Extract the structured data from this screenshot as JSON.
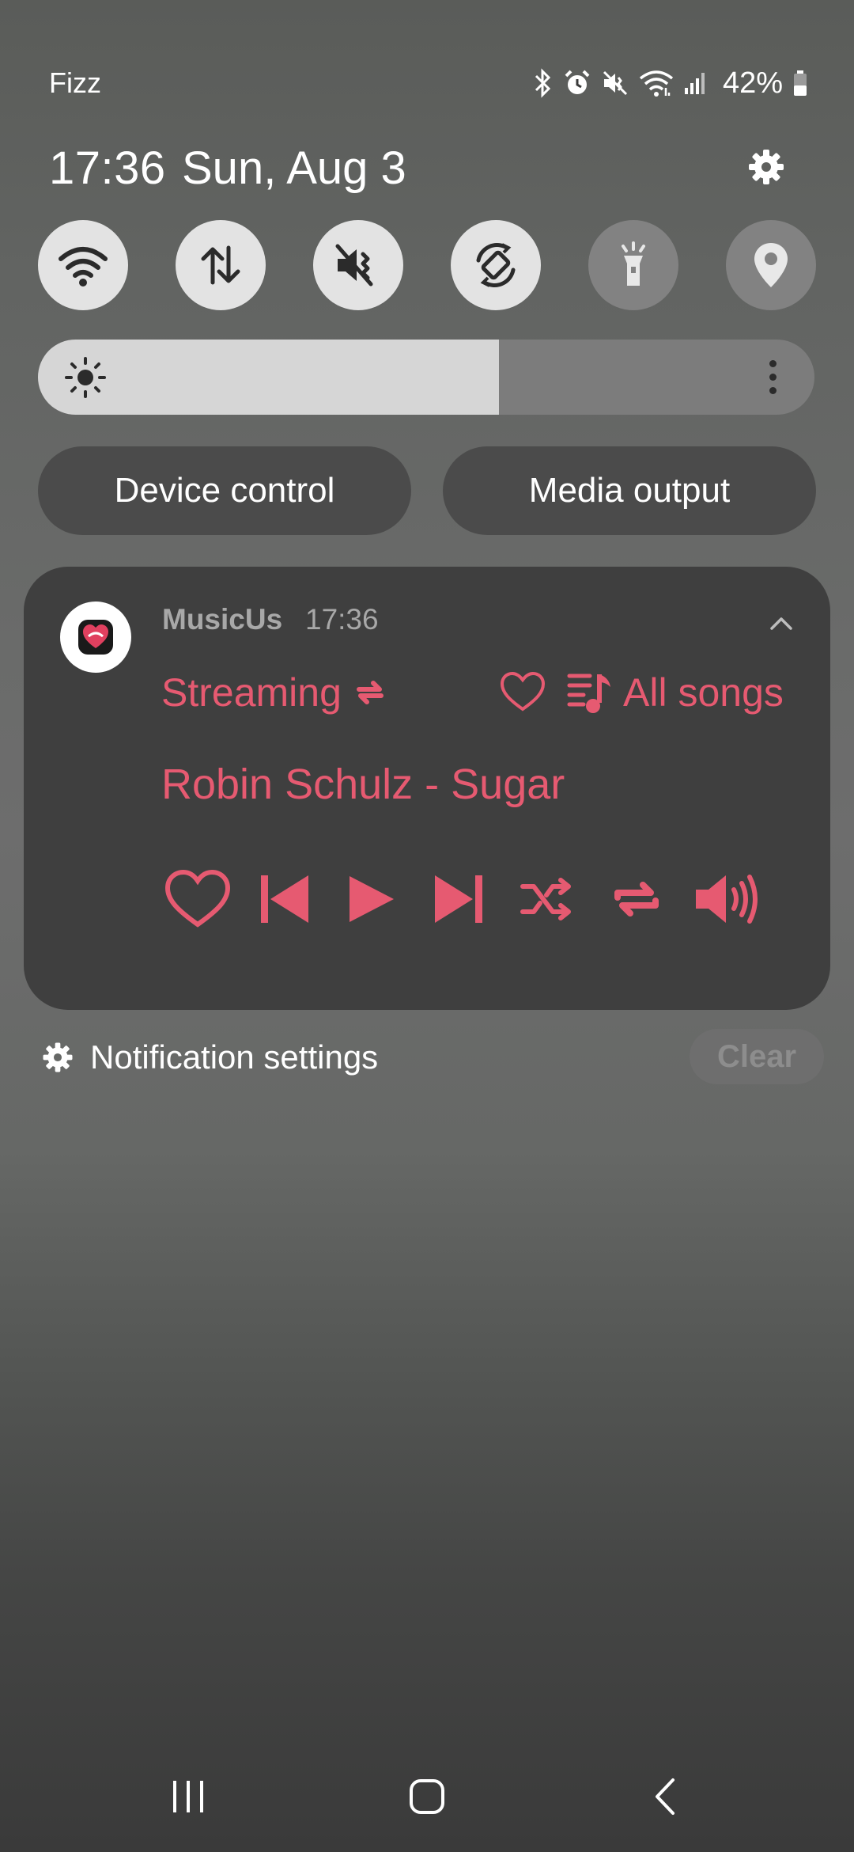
{
  "status_bar": {
    "carrier": "Fizz",
    "battery_percent": "42%",
    "icons": [
      "bluetooth-icon",
      "alarm-icon",
      "vibrate-mute-icon",
      "wifi-icon",
      "signal-icon",
      "battery-icon"
    ]
  },
  "header": {
    "time": "17:36",
    "date": "Sun, Aug 3",
    "settings_icon": "gear-icon"
  },
  "quick_tiles": [
    {
      "name": "wifi",
      "icon": "wifi-icon",
      "state": "on"
    },
    {
      "name": "mobile-data",
      "icon": "data-arrows-icon",
      "state": "on"
    },
    {
      "name": "sound",
      "icon": "mute-icon",
      "state": "on"
    },
    {
      "name": "auto-rotate",
      "icon": "rotate-icon",
      "state": "on"
    },
    {
      "name": "flashlight",
      "icon": "flashlight-icon",
      "state": "off"
    },
    {
      "name": "location",
      "icon": "location-pin-icon",
      "state": "off"
    }
  ],
  "brightness": {
    "level": 0.594
  },
  "buttons": {
    "device_control": "Device control",
    "media_output": "Media output"
  },
  "media": {
    "app_name": "MusicUs",
    "time": "17:36",
    "source": "Streaming",
    "queue": "All songs",
    "track": "Robin Schulz - Sugar",
    "accent_color": "#e65a71"
  },
  "footer": {
    "notification_settings": "Notification settings",
    "clear": "Clear"
  },
  "nav": {
    "recents_icon": "recents-icon",
    "home_icon": "home-icon",
    "back_icon": "back-icon"
  }
}
